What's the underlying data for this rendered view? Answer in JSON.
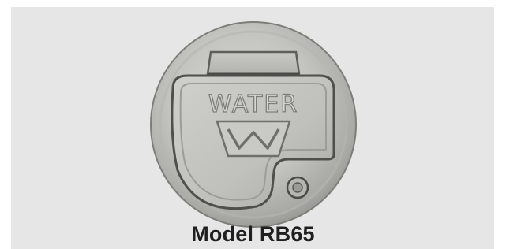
{
  "product": {
    "cover_lettering": "WATER",
    "cover_emblem": "W",
    "caption": "Model RB65"
  }
}
